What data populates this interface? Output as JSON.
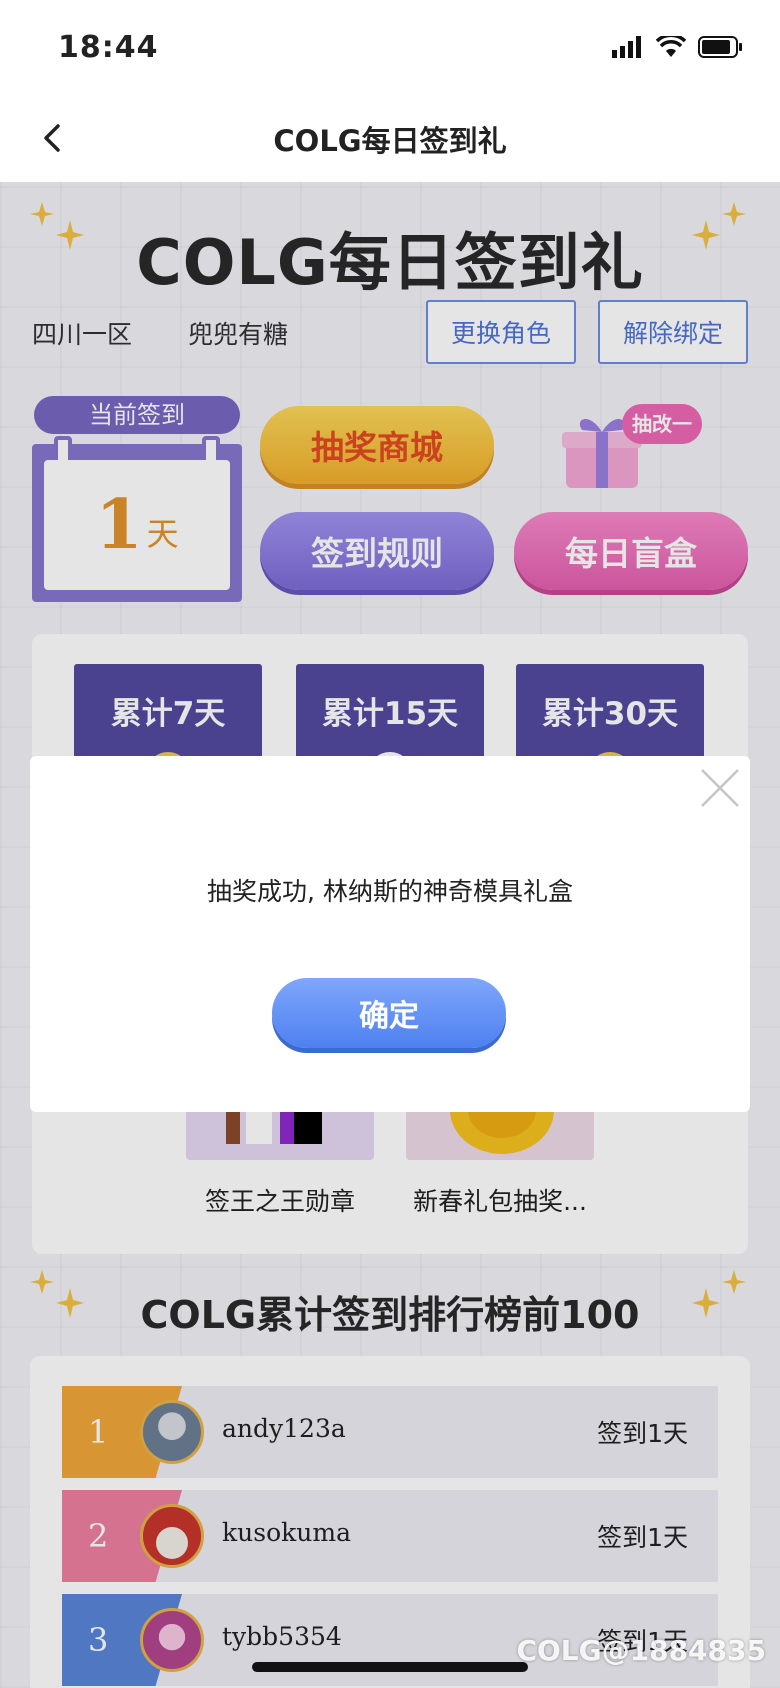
{
  "status_bar": {
    "time": "18:44"
  },
  "nav": {
    "title": "COLG每日签到礼"
  },
  "header": {
    "title": "COLG每日签到礼",
    "server": "四川一区",
    "role": "兜兜有糖",
    "change_role": "更换角色",
    "unbind": "解除绑定"
  },
  "checkin": {
    "label": "当前签到",
    "days": "1",
    "unit": "天"
  },
  "actions": {
    "lottery_mall": "抽奖商城",
    "rules": "签到规则",
    "daily_box": "每日盲盒",
    "gift_badge": "抽改一"
  },
  "rewards": {
    "tiers": [
      "累计7天",
      "累计15天",
      "累计30天"
    ],
    "items": [
      "签王之王勋章",
      "新春礼包抽奖..."
    ]
  },
  "ranking": {
    "title": "COLG累计签到排行榜前100",
    "rows": [
      {
        "rank": "1",
        "name": "andy123a",
        "days": "签到1天",
        "color": "#f0a63a"
      },
      {
        "rank": "2",
        "name": "kusokuma",
        "days": "签到1天",
        "color": "#ec7fa0"
      },
      {
        "rank": "3",
        "name": "tybb5354",
        "days": "签到1天",
        "color": "#5a86d8"
      }
    ]
  },
  "dialog": {
    "message": "抽奖成功, 林纳斯的神奇模具礼盒",
    "ok": "确定"
  },
  "watermark": "COLG@1884835",
  "colors": {
    "accent_blue": "#4d80f0",
    "purple": "#5349a0",
    "gold": "#f3c243"
  }
}
